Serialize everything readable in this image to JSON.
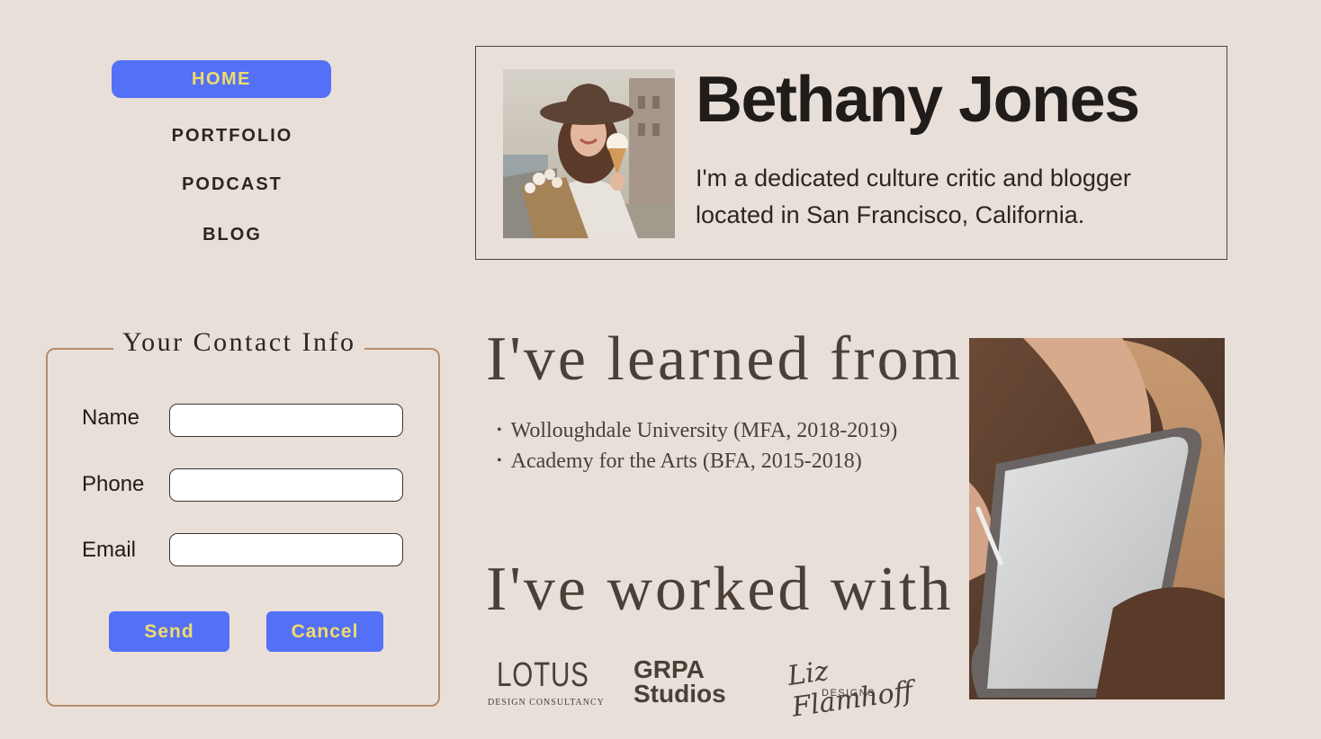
{
  "nav": {
    "home": "HOME",
    "portfolio": "PORTFOLIO",
    "podcast": "PODCAST",
    "blog": "BLOG"
  },
  "hero": {
    "name": "Bethany Jones",
    "bio_line1": "I'm a dedicated culture critic and blogger",
    "bio_line2": "located in San Francisco, California."
  },
  "contact": {
    "legend": "Your Contact Info",
    "name_label": "Name",
    "phone_label": "Phone",
    "email_label": "Email",
    "name_value": "",
    "phone_value": "",
    "email_value": "",
    "send_label": "Send",
    "cancel_label": "Cancel"
  },
  "education": {
    "heading": "I've learned from",
    "items": [
      "Wolloughdale University (MFA, 2018-2019)",
      "Academy for the Arts (BFA, 2015-2018)"
    ]
  },
  "work": {
    "heading": "I've worked with",
    "logos": {
      "lotus_main": "LOTUS",
      "lotus_sub": "DESIGN CONSULTANCY",
      "grpa_line1": "GRPA",
      "grpa_line2": "Studios",
      "liz_script": "Liz Flamhoff",
      "liz_sub": "DESIGNS"
    }
  },
  "colors": {
    "background": "#e8dfd8",
    "accent_button": "#5470f7",
    "button_text": "#f0dc6a",
    "form_border": "#b48e6c"
  },
  "icons": {
    "profile_photo": "woman-with-hat-and-ice-cream-photo",
    "tablet_photo": "hands-with-tablet-and-stylus-photo"
  }
}
